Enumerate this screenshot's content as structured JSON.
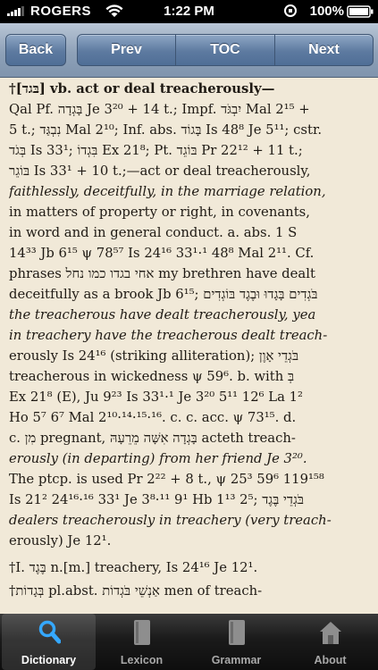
{
  "status_bar": {
    "carrier": "ROGERS",
    "time": "1:22 PM",
    "battery": "100%"
  },
  "toolbar": {
    "back": "Back",
    "prev": "Prev",
    "toc": "TOC",
    "next": "Next"
  },
  "entry": {
    "lines": [
      "†[בּגד] vb. act or deal treacherously—",
      "Qal Pf. בָּגְדָה Je 3²⁰ + 14 t.; Impf. יִבְגֹּד Mal 2¹⁵ +",
      "5 t.; נִבְגַּד Mal 2¹⁰; Inf. abs. בָּגוֹד Is 48⁸ Je 5¹¹; cstr.",
      "בְּגֹד Is 33¹; בִּגְדוֹ Ex 21⁸; Pt. בּוֹגֵד Pr 22¹² + 11 t.;",
      "בּוֹגֵר Is 33¹ + 10 t.;—act or deal treacherously,",
      "faithlessly, deceitfully, in the marriage relation,",
      "in matters of property or right, in covenants,",
      "in word and in general conduct.   a. abs. 1 S",
      "14³³ Jb 6¹⁵ ψ 78⁵⁷ Is 24¹⁶ 33¹·¹ 48⁸ Mal 2¹¹.   Cf.",
      "phrases אחי בגדו כמו נחל my brethren have dealt",
      "deceitfully as a brook Jb 6¹⁵; בֹּגְדִים בָּגָדוּ וּבֶגֶד בּוֹגְדִים",
      "the treacherous have dealt treacherously, yea",
      "in treachery have the treacherous dealt treach-",
      "erously Is 24¹⁶ (striking alliteration); בֹּגְדֵי אָוֶן",
      "treacherous in wickedness ψ 59⁶.   b. with בְּ",
      "Ex 21⁸ (E), Ju 9²³ Is 33¹·¹ Je 3²⁰ 5¹¹ 12⁶ La 1²",
      "Ho 5⁷ 6⁷ Mal 2¹⁰·¹⁴·¹⁵·¹⁶.   c. c. acc. ψ 73¹⁵.   d.",
      "c. מִן pregnant, בָּגְדָה אִשָּׁה מֵרֵעָהּ acteth treach-",
      "erously (in departing) from her friend Je 3²⁰.",
      "The ptcp. is used Pr 2²² + 8 t., ψ 25³ 59⁶ 119¹⁵⁸",
      "Is 21² 24¹⁶·¹⁶ 33¹ Je 3⁸·¹¹ 9¹ Hb 1¹³ 2⁵; בֹּגְדֵי בֶּגֶד",
      "dealers treacherously in treachery (very treach-",
      "erously) Je 12¹.",
      "†I. בֶּגֶד n.[m.] treachery, Is 24¹⁶ Je 12¹.",
      "†בְּגָדוֹת pl.abst. אַנְשֵׁי בֹּגְדוֹת men of treach-"
    ]
  },
  "tabs": [
    {
      "label": "Dictionary",
      "icon": "magnifier-icon",
      "active": true
    },
    {
      "label": "Lexicon",
      "icon": "book-icon",
      "active": false
    },
    {
      "label": "Grammar",
      "icon": "book-icon",
      "active": false
    },
    {
      "label": "About",
      "icon": "house-icon",
      "active": false
    }
  ],
  "colors": {
    "toolbar": "#8ea1b8",
    "button": "#5d7aa0",
    "page": "#f1e9d8",
    "tab_active_icon": "#35a8ff"
  }
}
